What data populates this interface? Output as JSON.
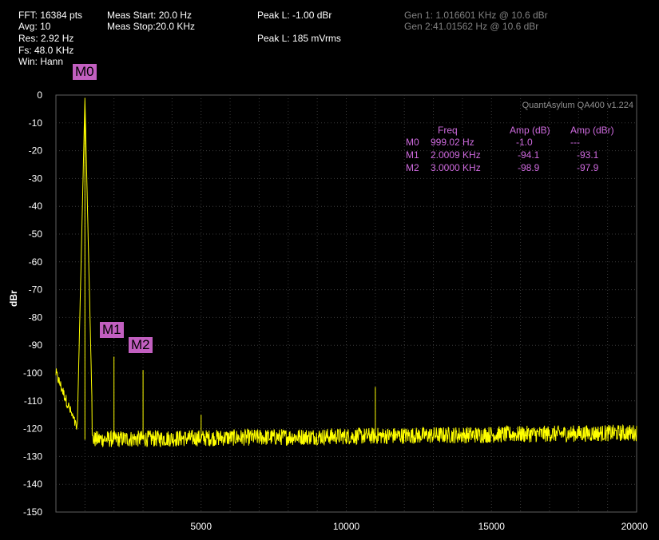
{
  "info": {
    "fft": "FFT: 16384 pts",
    "avg": "Avg: 10",
    "res": "Res: 2.92 Hz",
    "fs": "Fs: 48.0 KHz",
    "win": "Win: Hann",
    "meas_start": "Meas Start: 20.0 Hz",
    "meas_stop": "Meas Stop:20.0 KHz",
    "peak_dbr": "Peak L: -1.00 dBr",
    "peak_mv": "Peak L: 185 mVrms",
    "gen1": "Gen 1: 1.016601 KHz @ 10.6  dBr",
    "gen2": "Gen 2:41.01562 Hz @ 10.6  dBr"
  },
  "brand": "QuantAsylum QA400 v1.224",
  "marker_table": {
    "headers": [
      "Freq",
      "Amp (dB)",
      "Amp (dBr)"
    ],
    "rows": [
      {
        "name": "M0",
        "freq": "999.02 Hz",
        "amp_db": "-1.0",
        "amp_dbr": "---"
      },
      {
        "name": "M1",
        "freq": "2.0009 KHz",
        "amp_db": "-94.1",
        "amp_dbr": "-93.1"
      },
      {
        "name": "M2",
        "freq": "3.0000 KHz",
        "amp_db": "-98.9",
        "amp_dbr": "-97.9"
      }
    ]
  },
  "marker_flags": [
    "M0",
    "M1",
    "M2"
  ],
  "colors": {
    "trace": "#ffff00",
    "marker": "#c25fc0",
    "grid": "#3a3a3a",
    "axis": "#606060"
  },
  "chart_data": {
    "type": "line",
    "ylabel": "dBr",
    "xlim": [
      0,
      20000
    ],
    "ylim": [
      -150,
      0
    ],
    "x_ticks": [
      "5000",
      "10000",
      "15000",
      "20000"
    ],
    "y_ticks": [
      "0",
      "-10",
      "-20",
      "-30",
      "-40",
      "-50",
      "-60",
      "-70",
      "-80",
      "-90",
      "-100",
      "-110",
      "-120",
      "-130",
      "-140",
      "-150"
    ],
    "grid": true,
    "noise_floor_db": -124,
    "peaks": [
      {
        "x": 999,
        "y": -1.0
      },
      {
        "x": 2001,
        "y": -94.1
      },
      {
        "x": 3000,
        "y": -98.9
      },
      {
        "x": 5000,
        "y": -115
      },
      {
        "x": 11000,
        "y": -105
      }
    ],
    "markers": [
      {
        "name": "M0",
        "x": 999,
        "y": -1.0
      },
      {
        "name": "M1",
        "x": 2001,
        "y": -94.1
      },
      {
        "name": "M2",
        "x": 3000,
        "y": -98.9
      }
    ]
  }
}
